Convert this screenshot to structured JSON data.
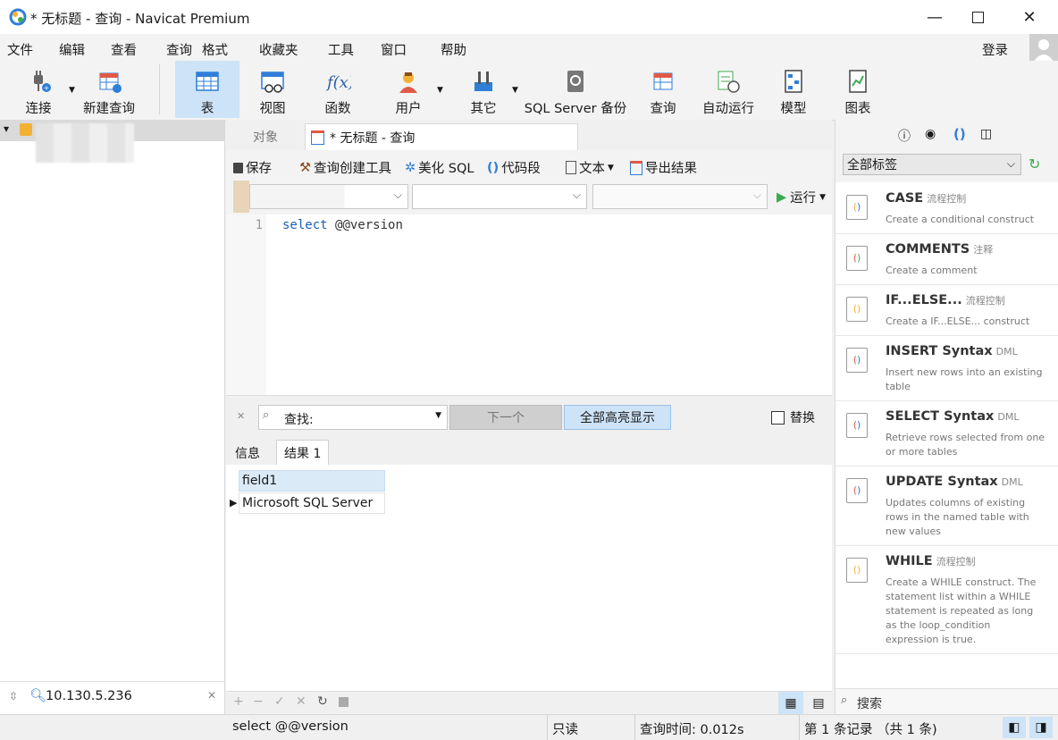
{
  "window": {
    "title": "* 无标题 - 查询 - Navicat Premium",
    "minimize_icon": "minimize-icon",
    "maximize_icon": "maximize-icon",
    "close_icon": "close-icon"
  },
  "menu": [
    "文件",
    "编辑",
    "查看",
    "查询",
    "格式",
    "收藏夹",
    "工具",
    "窗口",
    "帮助"
  ],
  "login_label": "登录",
  "toolbar": {
    "connect": "连接",
    "new_query": "新建查询",
    "table": "表",
    "view": "视图",
    "function": "函数",
    "user": "用户",
    "other": "其它",
    "backup": "SQL Server 备份",
    "query": "查询",
    "automation": "自动运行",
    "model": "模型",
    "chart": "图表"
  },
  "left_panel": {
    "search_value": "10.130.5.236"
  },
  "tabs": {
    "objects": "对象",
    "query_tab": "* 无标题 - 查询"
  },
  "query_toolbar": {
    "save": "保存",
    "query_builder": "查询创建工具",
    "beautify": "美化 SQL",
    "code_snippet": "代码段",
    "text": "文本",
    "export": "导出结果",
    "run": "运行"
  },
  "editor": {
    "line_number": "1",
    "keyword": "select",
    "rest": "@@version"
  },
  "find": {
    "label": "查找:",
    "next": "下一个",
    "highlight_all": "全部高亮显示",
    "replace": "替换"
  },
  "result_tabs": {
    "info": "信息",
    "result1": "结果 1"
  },
  "results": {
    "columns": [
      "field1"
    ],
    "rows": [
      [
        "Microsoft SQL Server"
      ]
    ]
  },
  "right_panel": {
    "tag_select": "全部标签",
    "snippets": [
      {
        "name": "CASE",
        "category": "流程控制",
        "desc": "Create a conditional construct"
      },
      {
        "name": "COMMENTS",
        "category": "注释",
        "desc": "Create a comment"
      },
      {
        "name": "IF...ELSE...",
        "category": "流程控制",
        "desc": "Create a IF...ELSE... construct"
      },
      {
        "name": "INSERT Syntax",
        "category": "DML",
        "desc": "Insert new rows into an existing table"
      },
      {
        "name": "SELECT Syntax",
        "category": "DML",
        "desc": "Retrieve rows selected from one or more tables"
      },
      {
        "name": "UPDATE Syntax",
        "category": "DML",
        "desc": "Updates columns of existing rows in the named table with new values"
      },
      {
        "name": "WHILE",
        "category": "流程控制",
        "desc": "Create a WHILE construct. The statement list within a WHILE statement is repeated as long as the loop_condition expression is true."
      }
    ],
    "search_placeholder": "搜索"
  },
  "status": {
    "sql": "select @@version",
    "readonly": "只读",
    "query_time": "查询时间: 0.012s",
    "records": "第 1 条记录 （共 1 条)"
  },
  "colors": {
    "accent": "#cde3f7",
    "keyword": "#1a5fb4",
    "selected_header": "#dbeaf7"
  }
}
